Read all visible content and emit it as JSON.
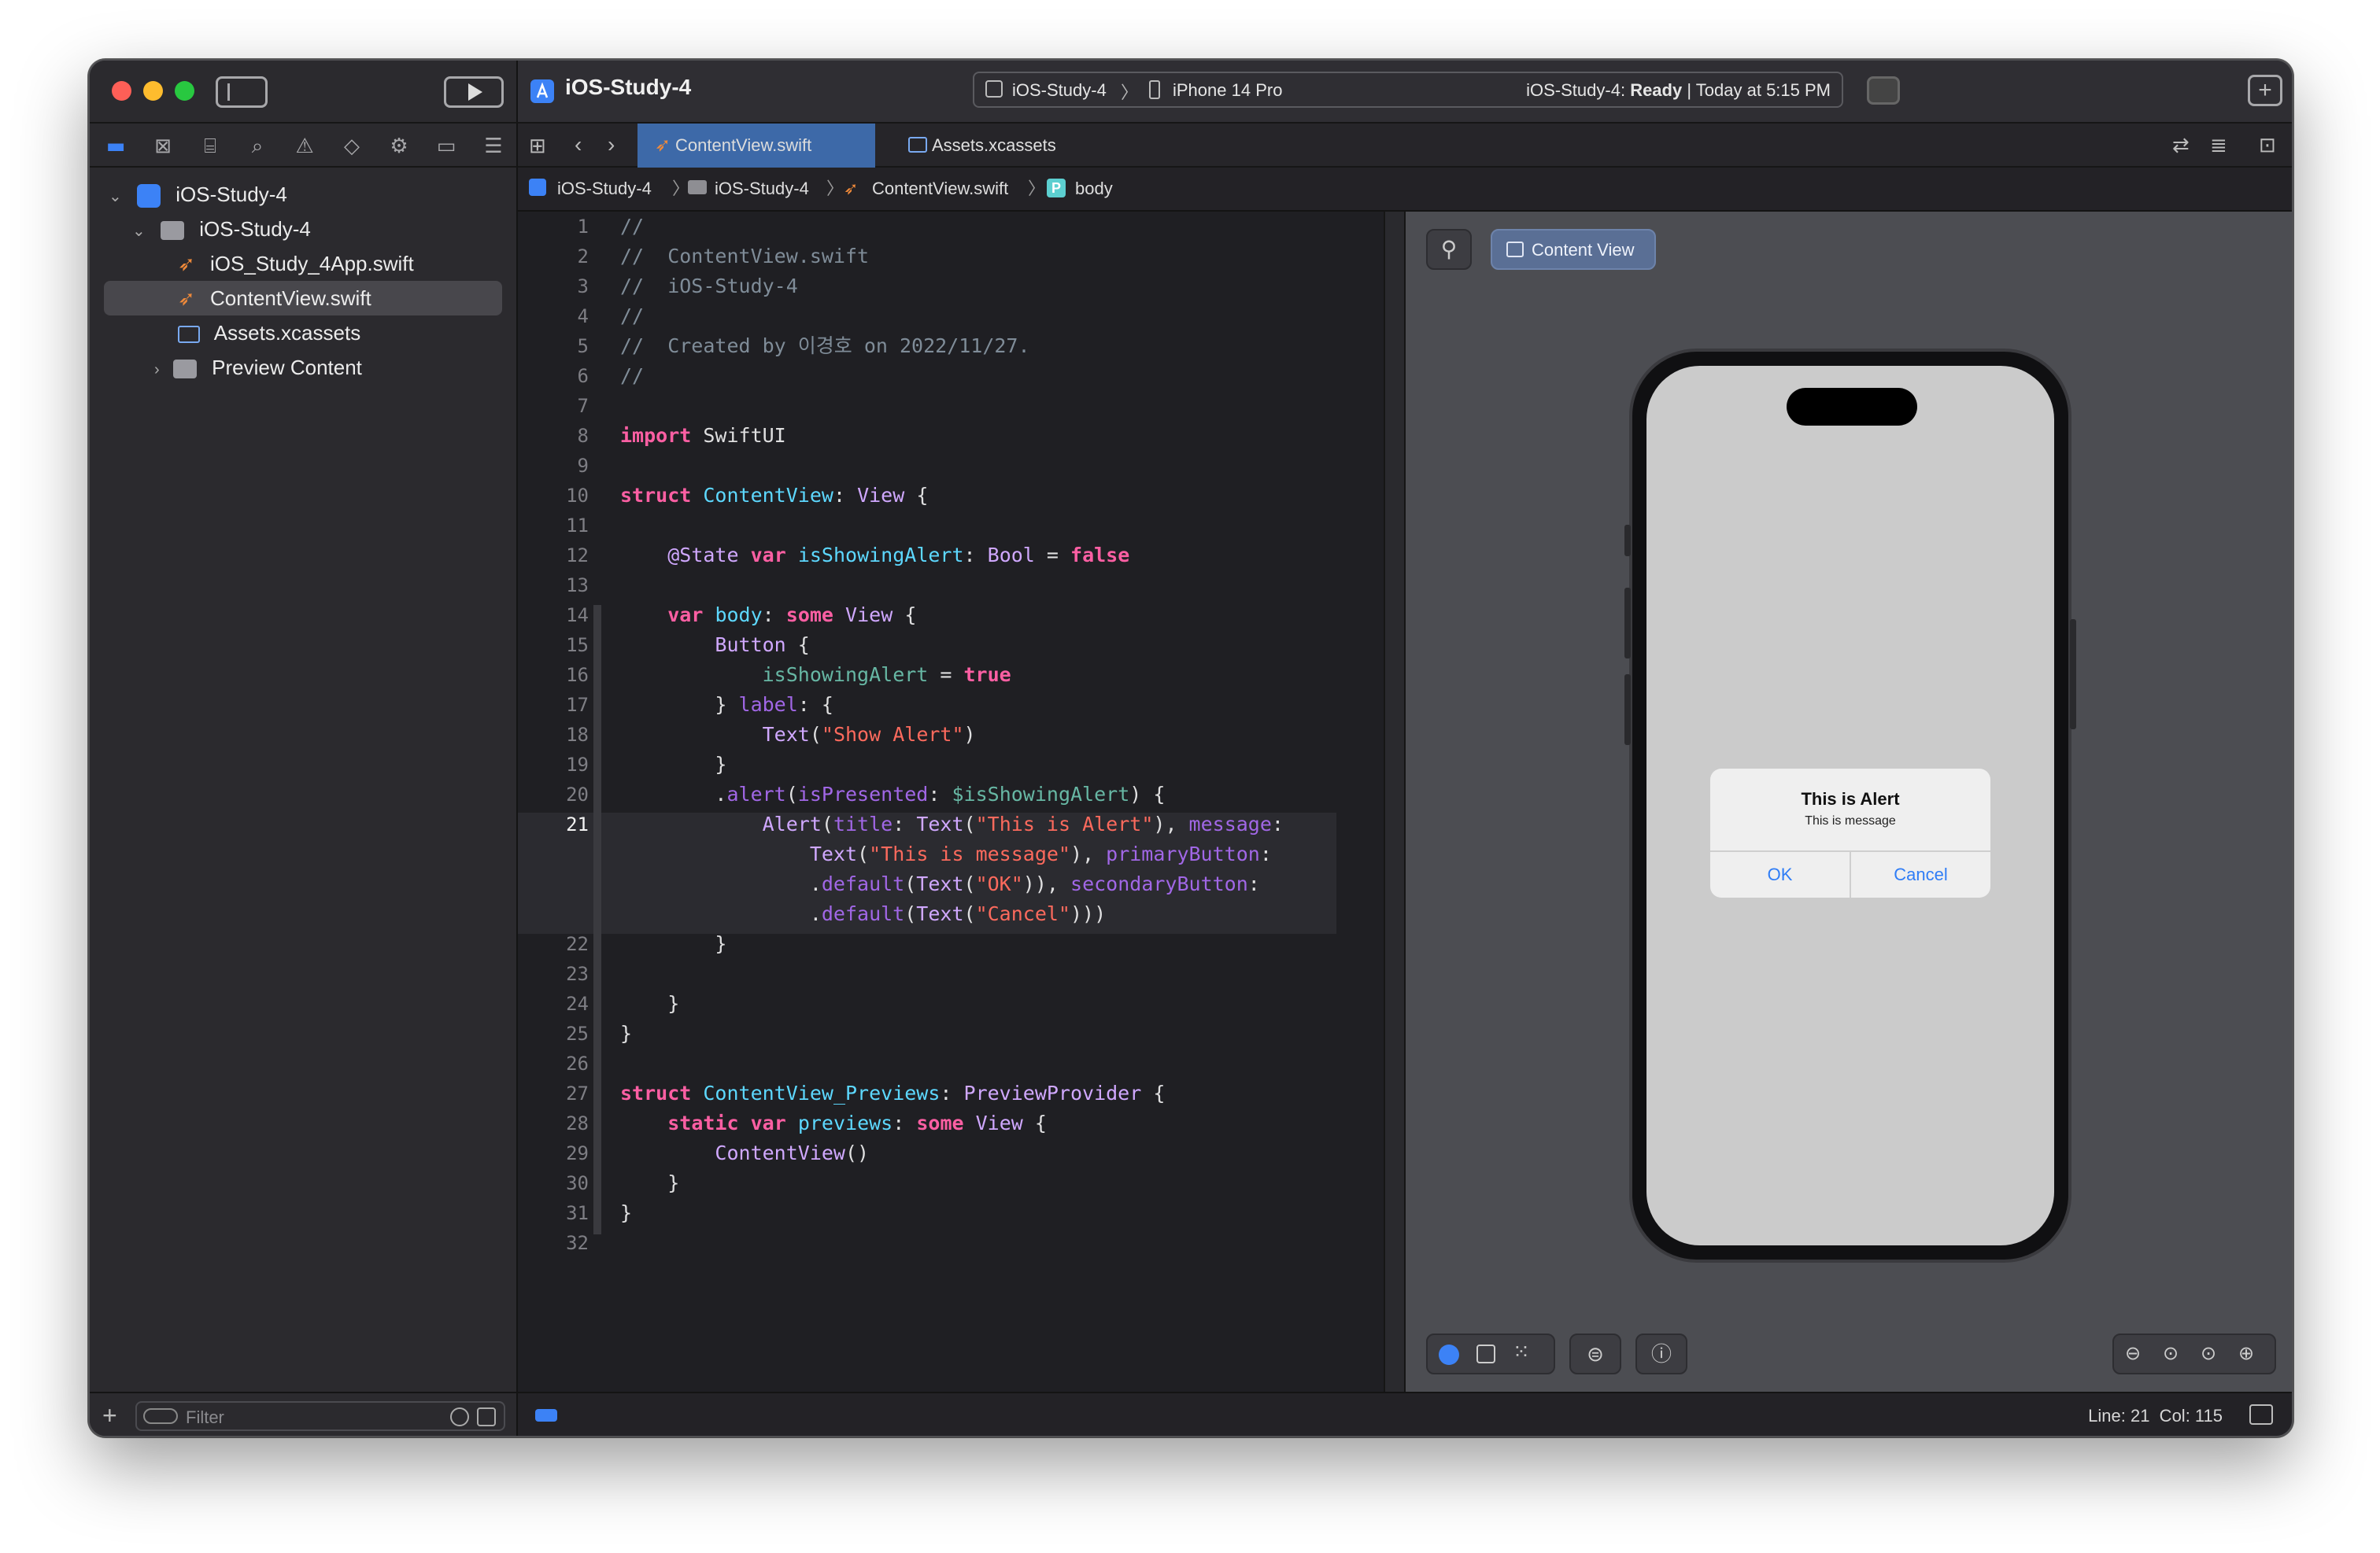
{
  "toolbar": {
    "project_title": "iOS-Study-4",
    "scheme": "iOS-Study-4",
    "device": "iPhone 14 Pro",
    "status_project": "iOS-Study-4:",
    "status_state": "Ready",
    "status_time": "| Today at 5:15 PM"
  },
  "tabs": [
    {
      "label": "ContentView.swift",
      "active": true
    },
    {
      "label": "Assets.xcassets",
      "active": false
    }
  ],
  "breadcrumb": [
    "iOS-Study-4",
    "iOS-Study-4",
    "ContentView.swift",
    "body"
  ],
  "breadcrumb_badge": "P",
  "navigator": {
    "items": [
      {
        "label": "iOS-Study-4",
        "level": 0,
        "icon": "project-icon"
      },
      {
        "label": "iOS-Study-4",
        "level": 1,
        "icon": "folder-icon"
      },
      {
        "label": "iOS_Study_4App.swift",
        "level": 2,
        "icon": "swift-file-icon"
      },
      {
        "label": "ContentView.swift",
        "level": 2,
        "icon": "swift-file-icon",
        "selected": true
      },
      {
        "label": "Assets.xcassets",
        "level": 2,
        "icon": "assets-icon"
      },
      {
        "label": "Preview Content",
        "level": 2,
        "icon": "folder-icon"
      }
    ],
    "filter_placeholder": "Filter"
  },
  "editor": {
    "line_numbers": [
      "1",
      "2",
      "3",
      "4",
      "5",
      "6",
      "7",
      "8",
      "9",
      "10",
      "11",
      "12",
      "13",
      "14",
      "15",
      "16",
      "17",
      "18",
      "19",
      "20",
      "21",
      "",
      "",
      "",
      "22",
      "23",
      "24",
      "25",
      "26",
      "27",
      "28",
      "29",
      "30",
      "31",
      "32"
    ],
    "current_line": "21"
  },
  "preview": {
    "label": "Content View",
    "alert_title": "This is Alert",
    "alert_message": "This is message",
    "alert_ok": "OK",
    "alert_cancel": "Cancel"
  },
  "status": {
    "position": "Line: 21  Col: 115"
  },
  "colors": {
    "accent": "#2f7df6",
    "keyword": "#fc5fa3",
    "string": "#fc6a5d",
    "type": "#d0a8ff",
    "comment": "#7f8c98"
  }
}
